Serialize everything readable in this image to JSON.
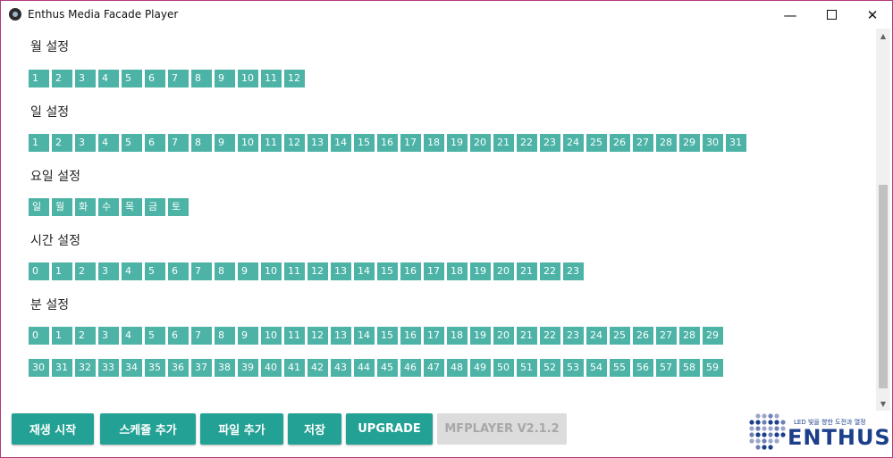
{
  "window": {
    "title": "Enthus Media Facade Player"
  },
  "sections": [
    {
      "title": "월 설정",
      "rows": [
        [
          "1",
          "2",
          "3",
          "4",
          "5",
          "6",
          "7",
          "8",
          "9",
          "10",
          "11",
          "12"
        ]
      ]
    },
    {
      "title": "일 설정",
      "rows": [
        [
          "1",
          "2",
          "3",
          "4",
          "5",
          "6",
          "7",
          "8",
          "9",
          "10",
          "11",
          "12",
          "13",
          "14",
          "15",
          "16",
          "17",
          "18",
          "19",
          "20",
          "21",
          "22",
          "23",
          "24",
          "25",
          "26",
          "27",
          "28",
          "29",
          "30",
          "31"
        ]
      ]
    },
    {
      "title": "요일 설정",
      "rows": [
        [
          "일",
          "월",
          "화",
          "수",
          "목",
          "금",
          "토"
        ]
      ]
    },
    {
      "title": "시간 설정",
      "rows": [
        [
          "0",
          "1",
          "2",
          "3",
          "4",
          "5",
          "6",
          "7",
          "8",
          "9",
          "10",
          "11",
          "12",
          "13",
          "14",
          "15",
          "16",
          "17",
          "18",
          "19",
          "20",
          "21",
          "22",
          "23"
        ]
      ]
    },
    {
      "title": "분 설정",
      "rows": [
        [
          "0",
          "1",
          "2",
          "3",
          "4",
          "5",
          "6",
          "7",
          "8",
          "9",
          "10",
          "11",
          "12",
          "13",
          "14",
          "15",
          "16",
          "17",
          "18",
          "19",
          "20",
          "21",
          "22",
          "23",
          "24",
          "25",
          "26",
          "27",
          "28",
          "29"
        ],
        [
          "30",
          "31",
          "32",
          "33",
          "34",
          "35",
          "36",
          "37",
          "38",
          "39",
          "40",
          "41",
          "42",
          "43",
          "44",
          "45",
          "46",
          "47",
          "48",
          "49",
          "50",
          "51",
          "52",
          "53",
          "54",
          "55",
          "56",
          "57",
          "58",
          "59"
        ]
      ]
    }
  ],
  "footer": {
    "play_label": "재생 시작",
    "schedule_label": "스케쥴 추가",
    "file_label": "파일 추가",
    "save_label": "저장",
    "upgrade_label": "UPGRADE",
    "version_label": "MFPLAYER V2.1.2"
  },
  "logo": {
    "tagline": "LED 빛을 향한 도전과 열정",
    "wordmark": "ENTHUS"
  },
  "colors": {
    "chip": "#4cb3a6",
    "button": "#23a194",
    "brand": "#1b3f8a"
  }
}
